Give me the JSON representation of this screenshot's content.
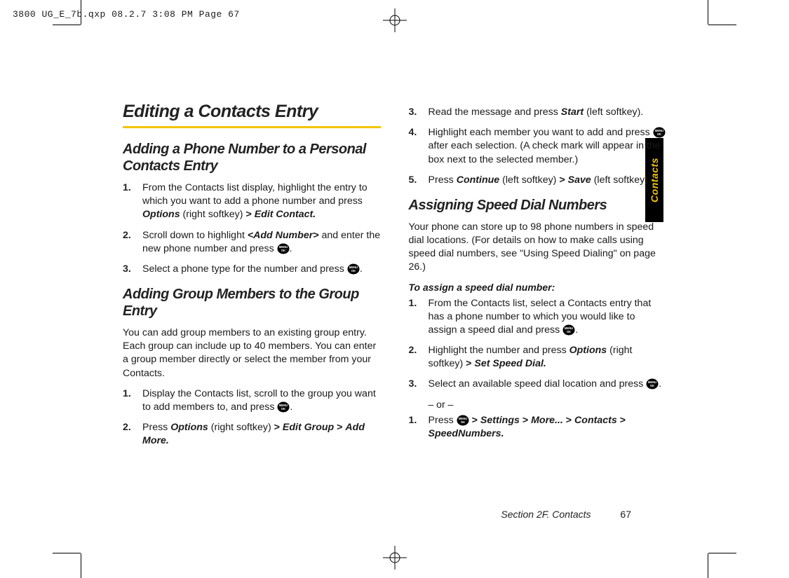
{
  "header_line": "3800 UG_E_7b.qxp  08.2.7  3:08 PM  Page 67",
  "side_tab": "Contacts",
  "footer_section": "Section 2F. Contacts",
  "footer_page": "67",
  "left": {
    "title": "Editing a Contacts Entry",
    "h2a": "Adding a Phone Number to a Personal Contacts Entry",
    "s1_1a": "From the Contacts list display, highlight the entry to which you want to add a phone number and press ",
    "s1_1b": "Options",
    "s1_1c": " (right softkey) ",
    "s1_1gt": ">",
    "s1_1d": " Edit Contact.",
    "s1_2a": "Scroll down to highlight ",
    "s1_2b": "<Add Number>",
    "s1_2c": " and enter the new phone number and press ",
    "s1_3a": "Select a phone type for the number and press ",
    "h2b": "Adding Group Members to the Group Entry",
    "p2": "You can add group members to an existing group entry. Each group can include up to 40 members. You can enter a group member directly or select the member from your Contacts.",
    "g1_1a": "Display the Contacts list, scroll to the group you want to add members to, and press ",
    "g1_2a": "Press ",
    "g1_2b": "Options",
    "g1_2c": " (right softkey) ",
    "g1_2d": "Edit Group",
    "g1_2e": "Add More."
  },
  "right": {
    "r3a": "Read the message and press ",
    "r3b": "Start",
    "r3c": " (left softkey).",
    "r4a": "Highlight each member you want to add and press ",
    "r4b": " after each selection. (A check mark will appear in the box next to the selected member.)",
    "r5a": "Press ",
    "r5b": "Continue",
    "r5c": " (left softkey) ",
    "r5d": "Save",
    "r5e": " (left softkey).",
    "h2c": "Assigning Speed Dial Numbers",
    "p3": "Your phone can store up to 98 phone numbers in speed dial locations. (For details on how to make calls using speed dial numbers, see \"Using Speed Dialing\" on page 26.)",
    "lead": "To assign a speed dial number:",
    "sd1a": "From the Contacts list, select a Contacts entry that has a phone number to which you would like to assign a speed dial and press ",
    "sd2a": "Highlight the number and press ",
    "sd2b": "Options",
    "sd2c": " (right softkey) ",
    "sd2d": "Set Speed Dial.",
    "sd3a": "Select an available speed dial location and press ",
    "or": "– or –",
    "alt1a": "Press ",
    "alt1b": "Settings",
    "alt1c": "More...",
    "alt1d": "Contacts",
    "alt1e": "SpeedNumbers."
  },
  "gt": ">"
}
